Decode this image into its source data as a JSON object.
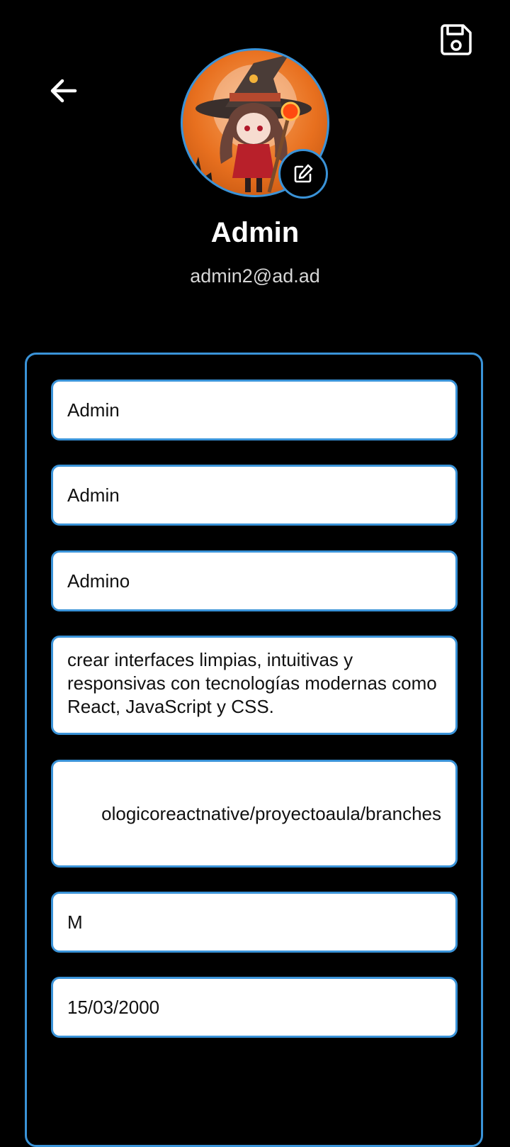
{
  "header": {
    "back_icon": "arrow-left-icon",
    "save_icon": "floppy-disk-icon"
  },
  "profile": {
    "name": "Admin",
    "email": "admin2@ad.ad",
    "avatar_icon": "avatar-image",
    "edit_avatar_icon": "edit-icon"
  },
  "form": {
    "first_name": "Admin",
    "last_name": "Admin",
    "second_last_name": "Admino",
    "bio": "crear interfaces limpias, intuitivas y responsivas con tecnologías modernas como React, JavaScript y CSS.",
    "url_visible": "ologicoreactnative/proyectoaula/branches",
    "gender": "M",
    "birth_date": "15/03/2000"
  },
  "colors": {
    "background": "#000000",
    "accent": "#3a93d8",
    "field_bg": "#ffffff",
    "avatar_orange": "#e8701f"
  }
}
